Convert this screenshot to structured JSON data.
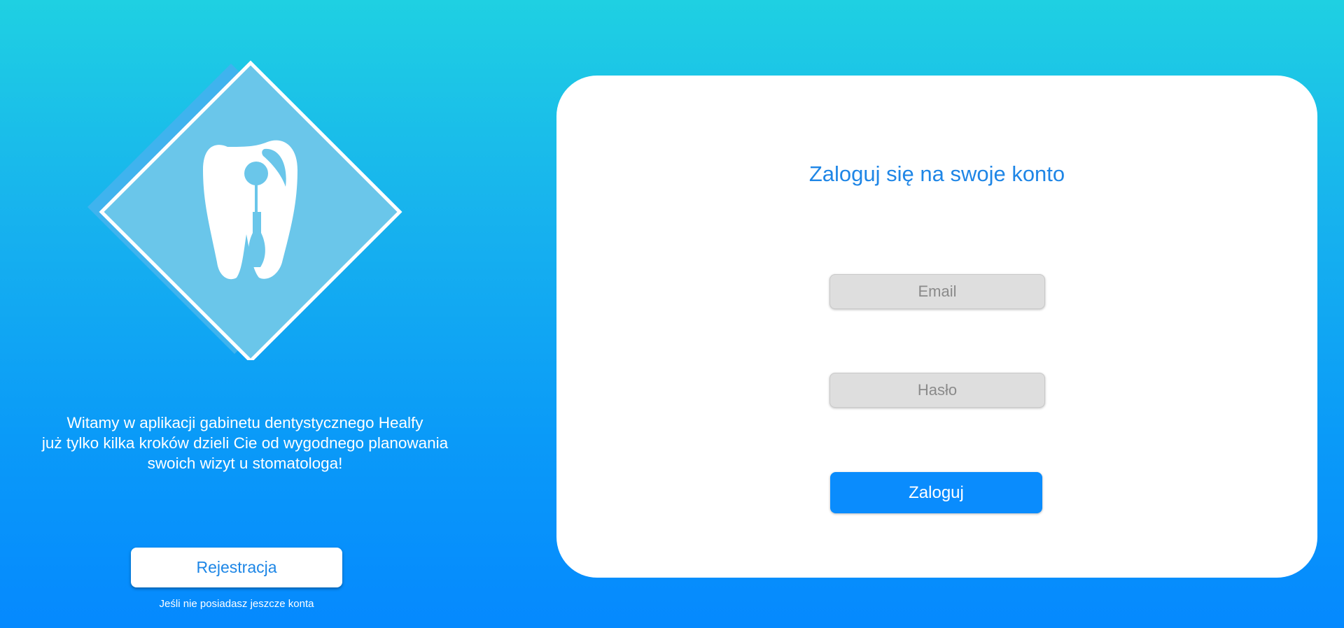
{
  "welcome": {
    "lines": [
      "Witamy w aplikacji gabinetu dentystycznego Healfy",
      "już tylko kilka kroków dzieli Cie od wygodnego planowania",
      "swoich wizyt u stomatologa!"
    ]
  },
  "register": {
    "button_label": "Rejestracja",
    "note": "Jeśli nie posiadasz jeszcze konta"
  },
  "login": {
    "title": "Zaloguj się na swoje konto",
    "email_placeholder": "Email",
    "password_placeholder": "Hasło",
    "button_label": "Zaloguj"
  },
  "icons": {
    "logo": "tooth-icon"
  },
  "colors": {
    "accent": "#1f86e6",
    "primary_button": "#0a8cfd",
    "logo_fill": "#6ac6ea",
    "logo_shadow": "#3fb3ee"
  }
}
